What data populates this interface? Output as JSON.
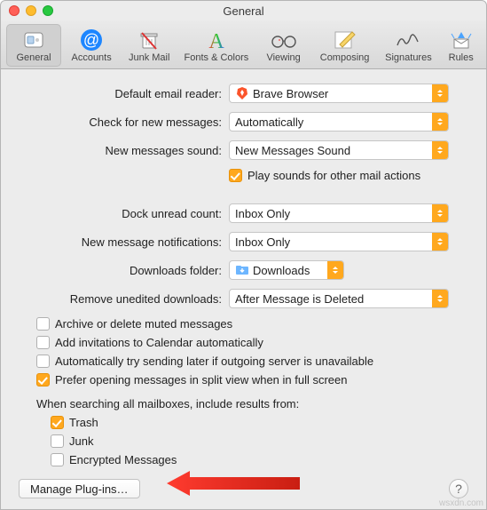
{
  "window": {
    "title": "General"
  },
  "toolbar": {
    "items": [
      {
        "label": "General"
      },
      {
        "label": "Accounts"
      },
      {
        "label": "Junk Mail"
      },
      {
        "label": "Fonts & Colors"
      },
      {
        "label": "Viewing"
      },
      {
        "label": "Composing"
      },
      {
        "label": "Signatures"
      },
      {
        "label": "Rules"
      }
    ]
  },
  "labels": {
    "default_reader": "Default email reader:",
    "check_new": "Check for new messages:",
    "new_sound": "New messages sound:",
    "play_sounds": "Play sounds for other mail actions",
    "dock_count": "Dock unread count:",
    "notifications": "New message notifications:",
    "downloads": "Downloads folder:",
    "remove_downloads": "Remove unedited downloads:",
    "archive_muted": "Archive or delete muted messages",
    "add_invites": "Add invitations to Calendar automatically",
    "auto_send_later": "Automatically try sending later if outgoing server is unavailable",
    "prefer_split": "Prefer opening messages in split view when in full screen",
    "search_heading": "When searching all mailboxes, include results from:",
    "trash": "Trash",
    "junk": "Junk",
    "encrypted": "Encrypted Messages",
    "manage_plugins": "Manage Plug-ins…"
  },
  "values": {
    "default_reader": "Brave Browser",
    "check_new": "Automatically",
    "new_sound": "New Messages Sound",
    "dock_count": "Inbox Only",
    "notifications": "Inbox Only",
    "downloads": "Downloads",
    "remove_downloads": "After Message is Deleted"
  },
  "watermark": "wsxdn.com"
}
